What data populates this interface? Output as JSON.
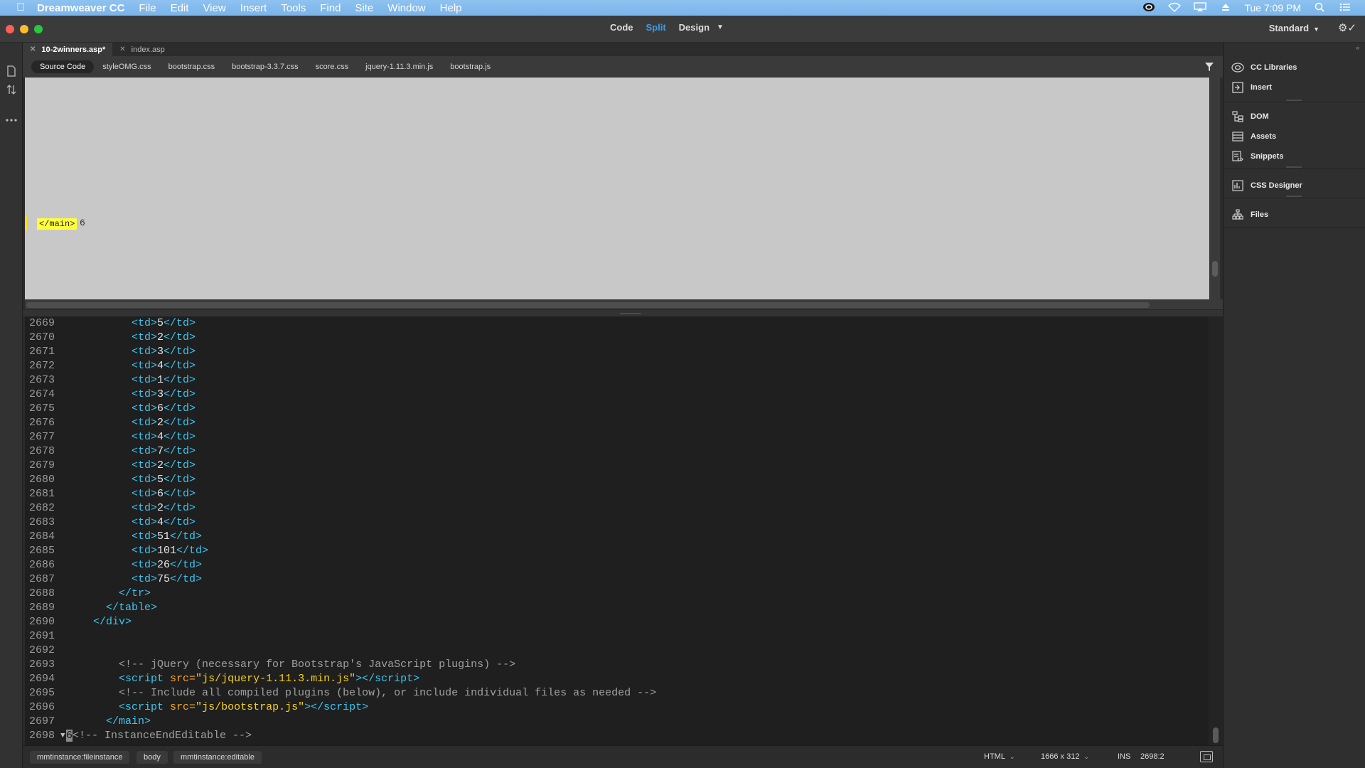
{
  "menubar": {
    "app_name": "Dreamweaver CC",
    "items": [
      "File",
      "Edit",
      "View",
      "Insert",
      "Tools",
      "Find",
      "Site",
      "Window",
      "Help"
    ],
    "clock": "Tue 7:09 PM"
  },
  "toolbar": {
    "view_code": "Code",
    "view_split": "Split",
    "view_design": "Design",
    "workspace": "Standard"
  },
  "doc_tabs": [
    {
      "label": "10-2winners.asp*",
      "active": true
    },
    {
      "label": "index.asp",
      "active": false
    }
  ],
  "related_files": [
    "Source Code",
    "styleOMG.css",
    "bootstrap.css",
    "bootstrap-3.3.7.css",
    "score.css",
    "jquery-1.11.3.min.js",
    "bootstrap.js"
  ],
  "design_view": {
    "tag": "</main>",
    "text": "6"
  },
  "code_lines": [
    {
      "n": "2669",
      "indent": "        ",
      "type": "td",
      "val": "5"
    },
    {
      "n": "2670",
      "indent": "        ",
      "type": "td",
      "val": "2"
    },
    {
      "n": "2671",
      "indent": "        ",
      "type": "td",
      "val": "3"
    },
    {
      "n": "2672",
      "indent": "        ",
      "type": "td",
      "val": "4"
    },
    {
      "n": "2673",
      "indent": "        ",
      "type": "td",
      "val": "1"
    },
    {
      "n": "2674",
      "indent": "        ",
      "type": "td",
      "val": "3"
    },
    {
      "n": "2675",
      "indent": "        ",
      "type": "td",
      "val": "6"
    },
    {
      "n": "2676",
      "indent": "        ",
      "type": "td",
      "val": "2"
    },
    {
      "n": "2677",
      "indent": "        ",
      "type": "td",
      "val": "4"
    },
    {
      "n": "2678",
      "indent": "        ",
      "type": "td",
      "val": "7"
    },
    {
      "n": "2679",
      "indent": "        ",
      "type": "td",
      "val": "2"
    },
    {
      "n": "2680",
      "indent": "        ",
      "type": "td",
      "val": "5"
    },
    {
      "n": "2681",
      "indent": "        ",
      "type": "td",
      "val": "6"
    },
    {
      "n": "2682",
      "indent": "        ",
      "type": "td",
      "val": "2"
    },
    {
      "n": "2683",
      "indent": "        ",
      "type": "td",
      "val": "4"
    },
    {
      "n": "2684",
      "indent": "        ",
      "type": "td",
      "val": "51"
    },
    {
      "n": "2685",
      "indent": "        ",
      "type": "td",
      "val": "101"
    },
    {
      "n": "2686",
      "indent": "        ",
      "type": "td",
      "val": "26"
    },
    {
      "n": "2687",
      "indent": "        ",
      "type": "td",
      "val": "75"
    },
    {
      "n": "2688",
      "indent": "      ",
      "type": "tag",
      "val": "</tr>"
    },
    {
      "n": "2689",
      "indent": "    ",
      "type": "tag",
      "val": "</table>"
    },
    {
      "n": "2690",
      "indent": "  ",
      "type": "tag",
      "val": "</div>"
    },
    {
      "n": "2691",
      "indent": "",
      "type": "blank",
      "val": ""
    },
    {
      "n": "2692",
      "indent": "",
      "type": "blank",
      "val": ""
    },
    {
      "n": "2693",
      "indent": "      ",
      "type": "comment",
      "val": "<!-- jQuery (necessary for Bootstrap's JavaScript plugins) -->"
    },
    {
      "n": "2694",
      "indent": "      ",
      "type": "script",
      "val": "js/jquery-1.11.3.min.js"
    },
    {
      "n": "2695",
      "indent": "      ",
      "type": "comment",
      "val": "<!-- Include all compiled plugins (below), or include individual files as needed -->"
    },
    {
      "n": "2696",
      "indent": "      ",
      "type": "script",
      "val": "js/bootstrap.js"
    },
    {
      "n": "2697",
      "indent": "    ",
      "type": "tag",
      "val": "</main>"
    },
    {
      "n": "2698",
      "indent": "",
      "type": "last",
      "cursor": "6",
      "val": "<!-- InstanceEndEditable -->"
    }
  ],
  "statusbar": {
    "breadcrumbs": [
      "mmtinstance:fileinstance",
      "body",
      "mmtinstance:editable"
    ],
    "doc_type": "HTML",
    "window_size": "1666 x 312",
    "mode": "INS",
    "position": "2698:2"
  },
  "panels": [
    {
      "label": "CC Libraries",
      "icon": "cc-libraries-icon"
    },
    {
      "label": "Insert",
      "icon": "insert-icon"
    },
    {
      "label": "DOM",
      "icon": "dom-icon"
    },
    {
      "label": "Assets",
      "icon": "assets-icon"
    },
    {
      "label": "Snippets",
      "icon": "snippets-icon"
    },
    {
      "label": "CSS Designer",
      "icon": "css-designer-icon"
    },
    {
      "label": "Files",
      "icon": "files-icon"
    }
  ],
  "colors": {
    "accent": "#3d9be9",
    "tag": "#3bc6f0",
    "string": "#f5d020",
    "attr": "#f5a623",
    "comment": "#a0a0a0"
  }
}
